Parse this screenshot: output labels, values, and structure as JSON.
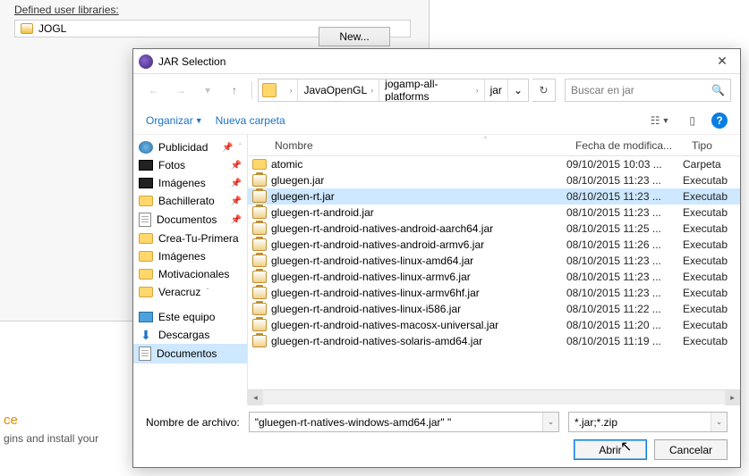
{
  "background": {
    "heading": "Defined user libraries:",
    "lib_name": "JOGL",
    "new_button": "New...",
    "marketplace_frag1": "ce",
    "marketplace_frag2": "gins and install your"
  },
  "dialog": {
    "title": "JAR Selection",
    "breadcrumbs": [
      "JavaOpenGL",
      "jogamp-all-platforms",
      "jar"
    ],
    "search_placeholder": "Buscar en jar",
    "organize": "Organizar",
    "new_folder": "Nueva carpeta",
    "columns": {
      "name": "Nombre",
      "date": "Fecha de modifica...",
      "type": "Tipo"
    },
    "sidebar": [
      {
        "icon": "pub",
        "label": "Publicidad",
        "pin": true,
        "scroll": "up"
      },
      {
        "icon": "img",
        "label": "Fotos",
        "pin": true
      },
      {
        "icon": "img",
        "label": "Imágenes",
        "pin": true
      },
      {
        "icon": "folder",
        "label": "Bachillerato",
        "pin": true
      },
      {
        "icon": "doc",
        "label": "Documentos",
        "pin": true
      },
      {
        "icon": "folder",
        "label": "Crea-Tu-Primera",
        "pin": false
      },
      {
        "icon": "folder",
        "label": "Imágenes",
        "pin": false
      },
      {
        "icon": "folder",
        "label": "Motivacionales",
        "pin": false
      },
      {
        "icon": "folder",
        "label": "Veracruz",
        "pin": false,
        "scroll": "down"
      },
      {
        "spacer": true
      },
      {
        "icon": "pc",
        "label": "Este equipo",
        "pin": false
      },
      {
        "icon": "dl",
        "label": "Descargas",
        "pin": false
      },
      {
        "icon": "doc",
        "label": "Documentos",
        "pin": false,
        "selected": true
      }
    ],
    "files": [
      {
        "icon": "folder",
        "name": "atomic",
        "date": "09/10/2015 10:03 ...",
        "type": "Carpeta"
      },
      {
        "icon": "jar",
        "name": "gluegen.jar",
        "date": "08/10/2015 11:23 ...",
        "type": "Executab"
      },
      {
        "icon": "jar",
        "name": "gluegen-rt.jar",
        "date": "08/10/2015 11:23 ...",
        "type": "Executab",
        "selected": true
      },
      {
        "icon": "jar",
        "name": "gluegen-rt-android.jar",
        "date": "08/10/2015 11:23 ...",
        "type": "Executab"
      },
      {
        "icon": "jar",
        "name": "gluegen-rt-android-natives-android-aarch64.jar",
        "date": "08/10/2015 11:25 ...",
        "type": "Executab"
      },
      {
        "icon": "jar",
        "name": "gluegen-rt-android-natives-android-armv6.jar",
        "date": "08/10/2015 11:26 ...",
        "type": "Executab"
      },
      {
        "icon": "jar",
        "name": "gluegen-rt-android-natives-linux-amd64.jar",
        "date": "08/10/2015 11:23 ...",
        "type": "Executab"
      },
      {
        "icon": "jar",
        "name": "gluegen-rt-android-natives-linux-armv6.jar",
        "date": "08/10/2015 11:23 ...",
        "type": "Executab"
      },
      {
        "icon": "jar",
        "name": "gluegen-rt-android-natives-linux-armv6hf.jar",
        "date": "08/10/2015 11:23 ...",
        "type": "Executab"
      },
      {
        "icon": "jar",
        "name": "gluegen-rt-android-natives-linux-i586.jar",
        "date": "08/10/2015 11:22 ...",
        "type": "Executab"
      },
      {
        "icon": "jar",
        "name": "gluegen-rt-android-natives-macosx-universal.jar",
        "date": "08/10/2015 11:20 ...",
        "type": "Executab"
      },
      {
        "icon": "jar",
        "name": "gluegen-rt-android-natives-solaris-amd64.jar",
        "date": "08/10/2015 11:19 ...",
        "type": "Executab"
      }
    ],
    "filename_label": "Nombre de archivo:",
    "filename_value": "\"gluegen-rt-natives-windows-amd64.jar\" \"",
    "filter_value": "*.jar;*.zip",
    "open_button": "Abrir",
    "cancel_button": "Cancelar"
  }
}
